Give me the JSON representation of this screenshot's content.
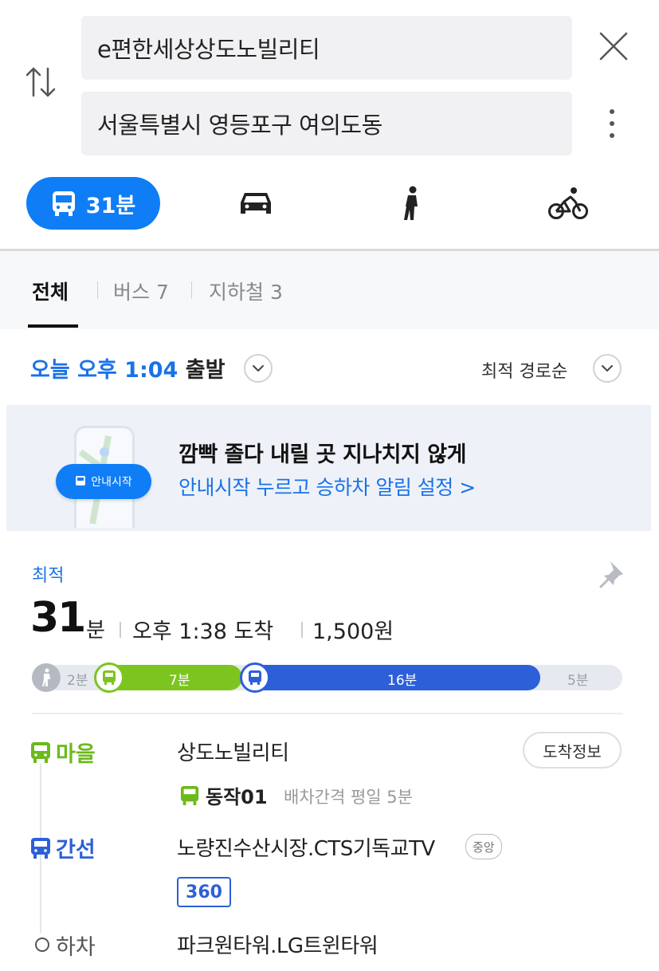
{
  "search": {
    "origin": "e편한세상상도노빌리티",
    "destination": "서울특별시 영등포구 여의도동"
  },
  "modes": [
    {
      "name": "bus",
      "label": "31분",
      "active": true
    },
    {
      "name": "car",
      "label": "",
      "active": false
    },
    {
      "name": "walk",
      "label": "",
      "active": false
    },
    {
      "name": "bike",
      "label": "",
      "active": false
    }
  ],
  "filter_tabs": [
    {
      "label": "전체",
      "active": true
    },
    {
      "label": "버스 7",
      "active": false
    },
    {
      "label": "지하철 3",
      "active": false
    }
  ],
  "depart": {
    "time_text": "오늘 오후 1:04",
    "suffix": "출발"
  },
  "sort": {
    "label": "최적 경로순"
  },
  "banner": {
    "line1": "깜빡 졸다 내릴 곳 지나치지 않게",
    "line2": "안내시작 누르고 승하차 알림 설정 >",
    "pill_label": "안내시작"
  },
  "route": {
    "tag": "최적",
    "minutes": "31",
    "minutes_unit": "분",
    "arrival": "오후 1:38 도착",
    "fare": "1,500원",
    "segments": [
      {
        "type": "walk",
        "label": "2분",
        "minutes": 2
      },
      {
        "type": "village-bus",
        "label": "7분",
        "minutes": 7
      },
      {
        "type": "trunk-bus",
        "label": "16분",
        "minutes": 16
      },
      {
        "type": "walk",
        "label": "5분",
        "minutes": 5
      }
    ],
    "legs": {
      "village": {
        "type_label": "마을",
        "stop": "상도노빌리티",
        "info_button": "도착정보",
        "route_no": "동작01",
        "interval": "배차간격 평일 5분"
      },
      "trunk": {
        "type_label": "간선",
        "stop": "노량진수산시장.CTS기독교TV",
        "direction_badge": "중앙",
        "bus_no": "360"
      },
      "alight": {
        "label": "하차",
        "stop": "파크원타워.LG트윈타워"
      }
    }
  },
  "colors": {
    "accent": "#0f7df6",
    "village_green": "#7cc521",
    "trunk_blue": "#2d5fd9"
  }
}
